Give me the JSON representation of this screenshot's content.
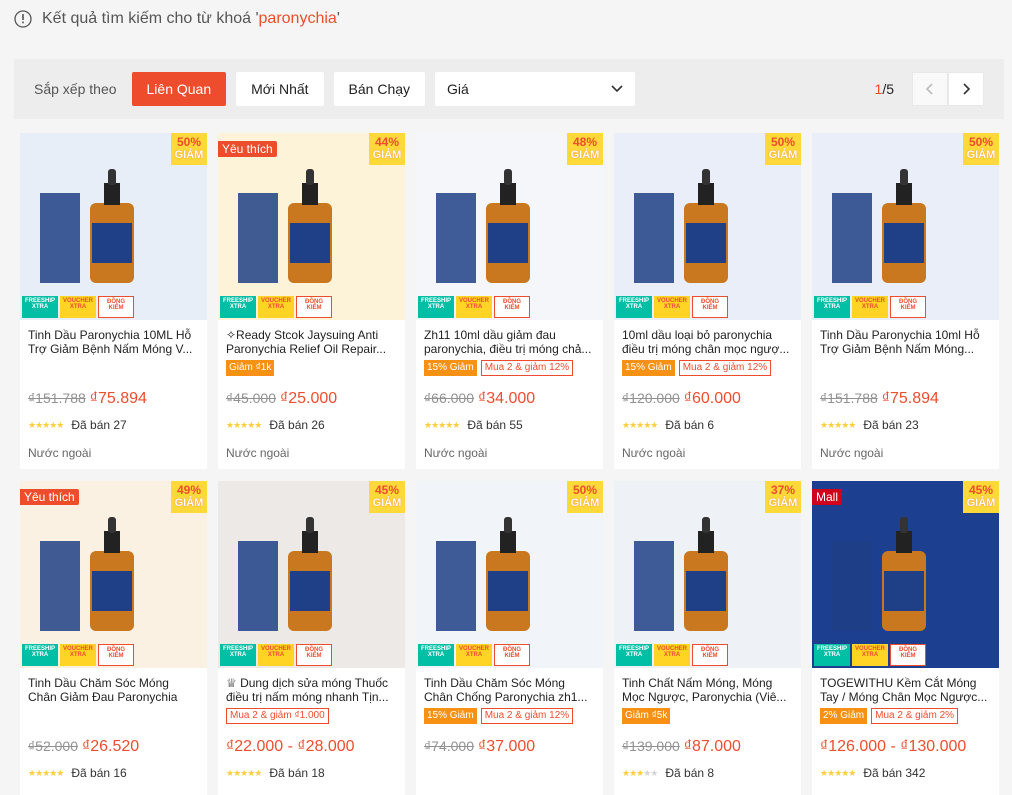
{
  "search": {
    "prefix": "Kết quả tìm kiếm cho từ khoá '",
    "keyword": "paronychia",
    "suffix": "'"
  },
  "sortbar": {
    "label": "Sắp xếp theo",
    "options": [
      "Liên Quan",
      "Mới Nhất",
      "Bán Chạy"
    ],
    "active": "Liên Quan",
    "price_label": "Giá",
    "page_current": "1",
    "page_total": "/5"
  },
  "colors": {
    "accent": "#ee4d2d",
    "star": "#ffce3d",
    "discount_bg": "#ffd839"
  },
  "products": [
    {
      "title": "Tinh Dầu Paronychia 10ML Hỗ Trợ Giảm Bệnh Nấm Móng V...",
      "old_price": "₫151.788",
      "price": "₫75.894",
      "sold": "Đã bán 27",
      "stars": 5,
      "location": "Nước ngoài",
      "discount": "50%",
      "off": "GIẢM",
      "ribbon": "",
      "tags": []
    },
    {
      "title": "✧Ready Stcok Jaysuing Anti Paronychia Relief Oil Repair...",
      "old_price": "₫45.000",
      "price": "₫25.000",
      "sold": "Đã bán 26",
      "stars": 5,
      "location": "Nước ngoài",
      "discount": "44%",
      "off": "GIẢM",
      "ribbon": "Yêu thích",
      "tags": [
        {
          "text": "Giảm ₫1k",
          "style": "fill"
        }
      ]
    },
    {
      "title": "Zh11 10ml dầu giảm đau paronychia, điều trị móng chả...",
      "old_price": "₫66.000",
      "price": "₫34.000",
      "sold": "Đã bán 55",
      "stars": 5,
      "location": "Nước ngoài",
      "discount": "48%",
      "off": "GIẢM",
      "ribbon": "",
      "tags": [
        {
          "text": "15% Giảm",
          "style": "fill"
        },
        {
          "text": "Mua 2 & giảm 12%",
          "style": "line"
        }
      ]
    },
    {
      "title": "10ml dầu loại bỏ paronychia điều trị móng chân mọc ngượ...",
      "old_price": "₫120.000",
      "price": "₫60.000",
      "sold": "Đã bán 6",
      "stars": 5,
      "location": "Nước ngoài",
      "discount": "50%",
      "off": "GIẢM",
      "ribbon": "",
      "tags": [
        {
          "text": "15% Giảm",
          "style": "fill"
        },
        {
          "text": "Mua 2 & giảm 12%",
          "style": "line"
        }
      ]
    },
    {
      "title": "Tinh Dầu Paronychia 10ml Hỗ Trợ Giảm Bệnh Nấm Móng...",
      "old_price": "₫151.788",
      "price": "₫75.894",
      "sold": "Đã bán 23",
      "stars": 5,
      "location": "Nước ngoài",
      "discount": "50%",
      "off": "GIẢM",
      "ribbon": "",
      "tags": []
    },
    {
      "title": "Tinh Dầu Chăm Sóc Móng Chân Giảm Đau Paronychia",
      "old_price": "₫52.000",
      "price": "₫26.520",
      "sold": "Đã bán 16",
      "stars": 4.5,
      "location": "",
      "discount": "49%",
      "off": "GIẢM",
      "ribbon": "Yêu thích",
      "tags": []
    },
    {
      "title": "♕ Dung dịch sửa móng Thuốc điều trị nấm móng nhanh Tịn...",
      "old_price": "",
      "price": "₫22.000 - ₫28.000",
      "sold": "Đã bán 18",
      "stars": 5,
      "location": "",
      "discount": "45%",
      "off": "GIẢM",
      "ribbon": "",
      "tags": [
        {
          "text": "Mua 2 & giảm ₫1.000",
          "style": "line"
        }
      ]
    },
    {
      "title": "Tinh Dầu Chăm Sóc Móng Chân Chống Paronychia zh1...",
      "old_price": "₫74.000",
      "price": "₫37.000",
      "sold": "",
      "stars": 0,
      "location": "",
      "discount": "50%",
      "off": "GIẢM",
      "ribbon": "",
      "tags": [
        {
          "text": "15% Giảm",
          "style": "fill"
        },
        {
          "text": "Mua 2 & giảm 12%",
          "style": "line"
        }
      ]
    },
    {
      "title": "Tinh Chất Nấm Móng, Móng Mọc Ngược, Paronychia (Viê...",
      "old_price": "₫139.000",
      "price": "₫87.000",
      "sold": "Đã bán 8",
      "stars": 2.5,
      "location": "",
      "discount": "37%",
      "off": "GIẢM",
      "ribbon": "",
      "tags": [
        {
          "text": "Giảm ₫5k",
          "style": "fill"
        }
      ]
    },
    {
      "title": "TOGEWITHU Kềm Cắt Móng Tay / Móng Chân Mọc Ngược...",
      "old_price": "",
      "price": "₫126.000 - ₫130.000",
      "sold": "Đã bán 342",
      "stars": 5,
      "location": "",
      "discount": "45%",
      "off": "GIẢM",
      "ribbon": "Mall",
      "tags": [
        {
          "text": "2% Giảm",
          "style": "fill"
        },
        {
          "text": "Mua 2 & giảm 2%",
          "style": "line"
        }
      ]
    }
  ],
  "thumb_colors": [
    "#e8eef7",
    "#fdf3d8",
    "#f4f6fa",
    "#e9eef8",
    "#e9eef8",
    "#fbf1e3",
    "#ece9e6",
    "#f1f4f8",
    "#eef1f6",
    "#1c3f8f"
  ],
  "badges": {
    "freeship": "FREESHIP XTRA",
    "voucher": "VOUCHER XTRA",
    "dongkiem": "ĐỒNG KIỂM"
  }
}
